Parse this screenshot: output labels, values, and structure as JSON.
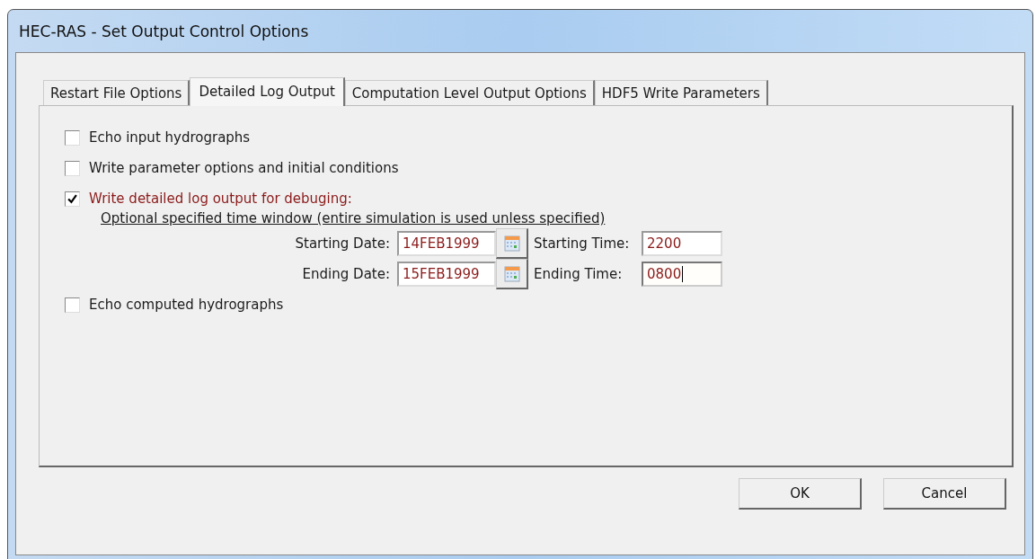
{
  "window": {
    "title": "HEC-RAS - Set Output Control Options"
  },
  "tabs": [
    {
      "label": "Restart File Options",
      "selected": false
    },
    {
      "label": "Detailed Log Output",
      "selected": true
    },
    {
      "label": "Computation Level Output Options",
      "selected": false
    },
    {
      "label": "HDF5 Write Parameters",
      "selected": false
    }
  ],
  "options": [
    {
      "label": "Echo input hydrographs",
      "checked": false
    },
    {
      "label": "Write parameter options and initial conditions",
      "checked": false
    },
    {
      "label": "Write detailed log output for debuging:",
      "checked": true,
      "time_window": {
        "caption": "Optional specified time window (entire simulation is used unless specified)",
        "rows": [
          {
            "date_label": "Starting Date:",
            "date": "14FEB1999",
            "time_label": "Starting Time:",
            "time": "2200",
            "focused": false
          },
          {
            "date_label": "Ending Date:",
            "date": "15FEB1999",
            "time_label": "Ending Time:",
            "time": "0800",
            "focused": true
          }
        ]
      }
    },
    {
      "label": "Echo computed hydrographs",
      "checked": false
    }
  ],
  "buttons": [
    "OK",
    "Cancel"
  ]
}
